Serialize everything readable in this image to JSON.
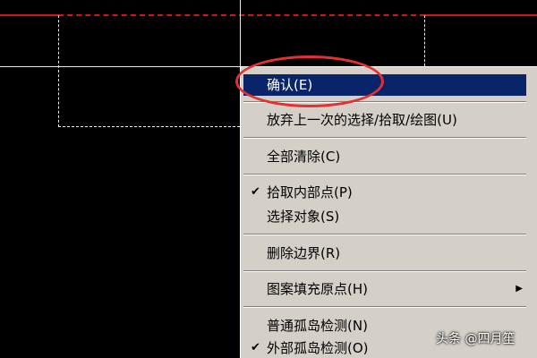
{
  "menu": {
    "items": [
      {
        "label": "确认(E)",
        "selected": true
      },
      {
        "label": "放弃上一次的选择/拾取/绘图(U)"
      },
      {
        "label": "全部清除(C)"
      },
      {
        "label": "拾取内部点(P)",
        "checked": true
      },
      {
        "label": "选择对象(S)"
      },
      {
        "label": "删除边界(R)"
      },
      {
        "label": "图案填充原点(H)",
        "has_submenu": true
      },
      {
        "label": "普通孤岛检测(N)"
      },
      {
        "label": "外部孤岛检测(O)",
        "checked": true
      }
    ]
  },
  "icons": {
    "check": "checkmark-icon",
    "submenu": "triangle-right-icon"
  },
  "colors": {
    "menu_bg": "#d4d0c8",
    "selected_bg": "#0a246a",
    "annotation": "#e53030",
    "cad_red": "#d01818"
  },
  "watermark": {
    "text": "头条 @四月笙"
  }
}
